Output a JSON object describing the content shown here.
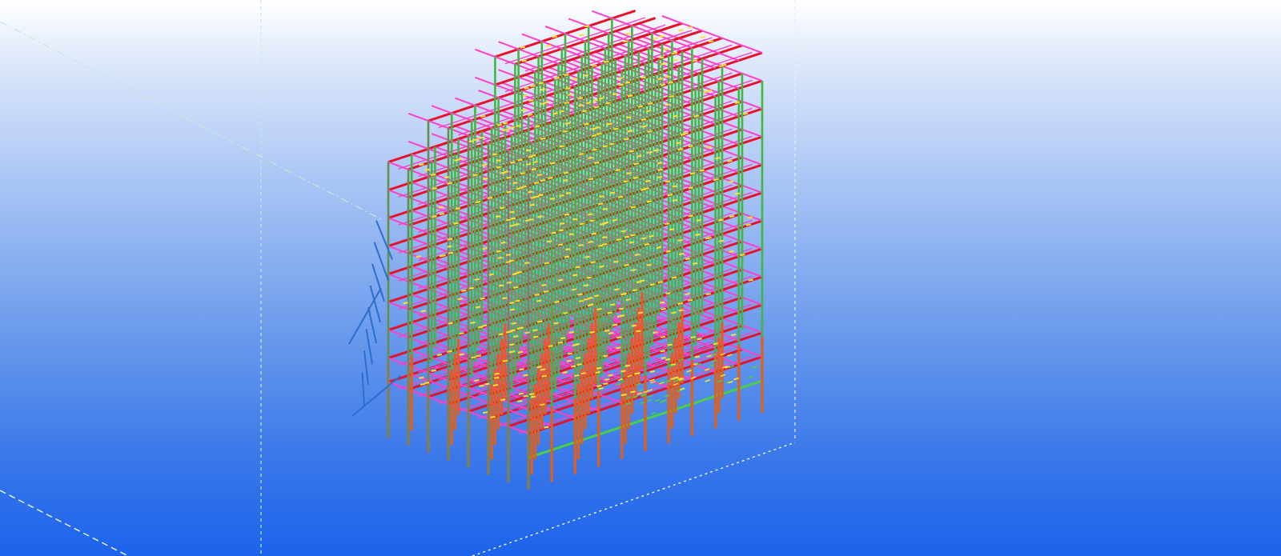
{
  "viewport": {
    "view_name": "3D model view",
    "background_top": "#ffffff",
    "background_bottom": "#1c63ec"
  },
  "model": {
    "colors": {
      "beams_main": "#e8102a",
      "beams_secondary": "#ff40c8",
      "columns_upper": "#3fb83f",
      "columns_lower": "#e0601a",
      "bracing": "#2a6fd0",
      "connections": "#ffe030",
      "ground_beams": "#48d048"
    },
    "grid_lines_color": "#c8e8d8"
  }
}
